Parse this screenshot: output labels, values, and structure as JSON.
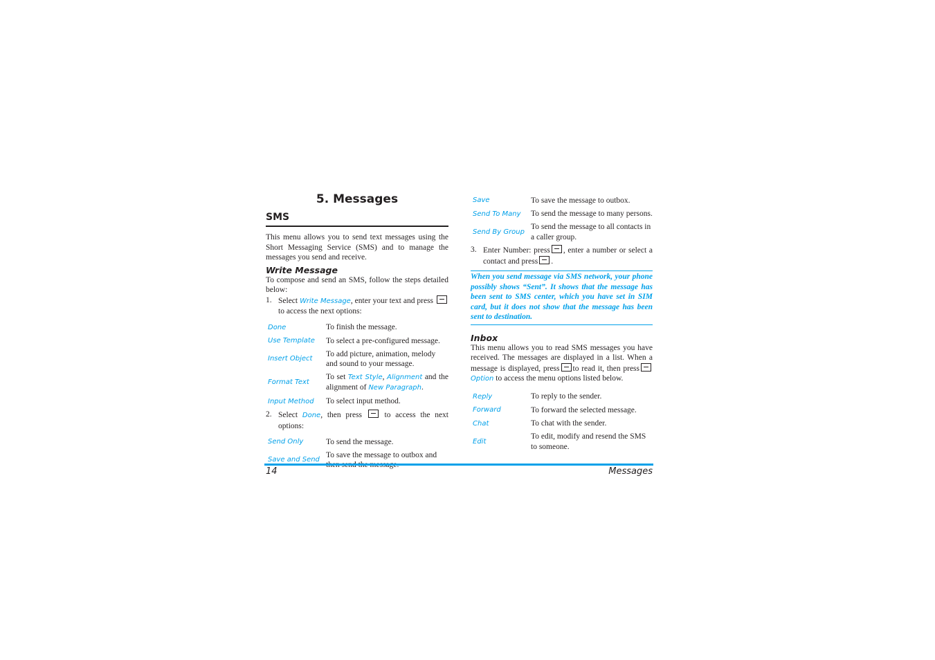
{
  "chapter_title": "5. Messages",
  "section_title": "SMS",
  "intro": "This menu allows you to send text messages using the Short Messaging Service (SMS) and to manage the messages you send and receive.",
  "write_message": {
    "heading": "Write Message",
    "intro": "To compose and send an SMS, follow the steps detailed below:",
    "step1": {
      "num": "1.",
      "pre": "Select ",
      "link": "Write Message",
      "post": ", enter your text and press",
      "post2": " to access the next options:"
    },
    "options1": [
      {
        "key": "Done",
        "desc": "To finish the message."
      },
      {
        "key": "Use Template",
        "desc": "To select a pre-configured message."
      },
      {
        "key": "Insert Object",
        "desc": "To add picture, animation, melody and sound to your message."
      },
      {
        "key": "Format Text",
        "desc_pre": "To set ",
        "link1": "Text Style",
        "sep": ", ",
        "link2": "Alignment",
        "mid": " and the alignment of ",
        "link3": "New Paragraph",
        "end": "."
      },
      {
        "key": "Input Method",
        "desc": "To select input method."
      }
    ],
    "step2": {
      "num": "2.",
      "pre": "Select ",
      "link": "Done",
      "post": ", then press",
      "post2": " to access the next options:"
    },
    "options2": [
      {
        "key": "Send Only",
        "desc": "To send the message."
      },
      {
        "key": "Save and Send",
        "desc": "To save the message to outbox and then send the message."
      },
      {
        "key": "Save",
        "desc": "To save the message to outbox."
      },
      {
        "key": "Send To Many",
        "desc": "To send the message to many persons."
      },
      {
        "key": "Send By Group",
        "desc": "To send the message to all contacts in a caller group."
      }
    ],
    "step3": {
      "num": "3.",
      "pre": "Enter Number: press",
      "mid": ", enter a number or select a contact and press",
      "end": "."
    },
    "note": "When you send message via SMS network, your phone possibly shows “Sent”. It shows that the message has been sent to SMS center, which you have set in SIM card, but it does not show that the message has been sent to destination."
  },
  "inbox": {
    "heading": "Inbox",
    "intro_pre": "This menu allows you to read SMS messages you have received. The messages are displayed in a list. When a message is displayed, press",
    "intro_mid": "to read it, then press",
    "intro_link": "Option",
    "intro_post": " to access the menu options listed below.",
    "options": [
      {
        "key": "Reply",
        "desc": "To reply to the sender."
      },
      {
        "key": "Forward",
        "desc": "To forward the selected message."
      },
      {
        "key": "Chat",
        "desc": "To chat with the sender."
      },
      {
        "key": "Edit",
        "desc": "To edit, modify and resend the SMS to someone."
      }
    ]
  },
  "footer": {
    "page_number": "14",
    "title": "Messages"
  },
  "colors": {
    "accent": "#00a0e9",
    "text": "#231f20"
  }
}
